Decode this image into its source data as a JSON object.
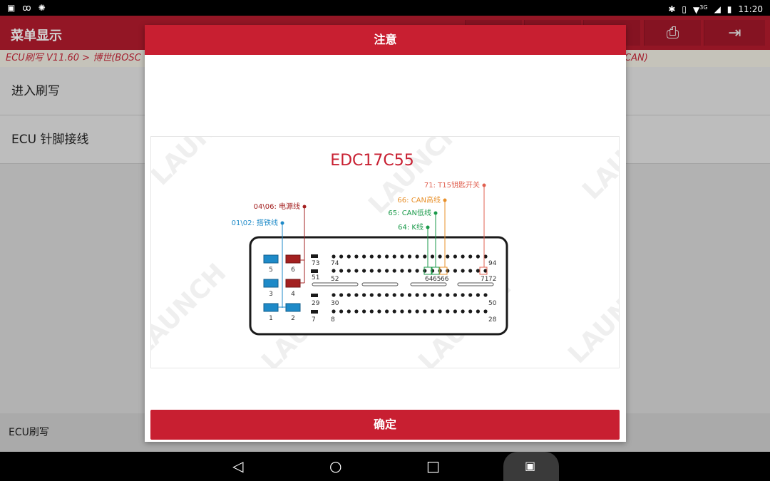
{
  "status_bar": {
    "time": "11:20",
    "network": "3G",
    "left_icons": [
      "image-icon",
      "voicemail-icon",
      "bug-icon"
    ],
    "right_icons": [
      "bluetooth-icon",
      "vibrate-icon",
      "wifi-icon",
      "signal-icon",
      "battery-icon"
    ]
  },
  "app_bar": {
    "title": "菜单显示",
    "toolbar_icons": [
      "print-icon",
      "exit-icon"
    ]
  },
  "breadcrumb": {
    "left": "ECU刷写 V11.60 > 博世(BOSC",
    "right": "CAN)"
  },
  "menu": {
    "items": [
      {
        "label": "进入刷写"
      },
      {
        "label": "ECU 针脚接线"
      }
    ]
  },
  "footer": {
    "label": "ECU刷写"
  },
  "dialog": {
    "title": "注意",
    "confirm_label": "确定",
    "diagram": {
      "model": "EDC17C55",
      "watermark": "LAUNCH",
      "annotations": {
        "t15": "71: T15钥匙开关",
        "can_high": "66: CAN高线",
        "power": "04\\06: 电源线",
        "can_low": "65: CAN低线",
        "ground": "01\\02: 搭铁线",
        "kline": "64: K线"
      },
      "pin_numbers": {
        "p73": "73",
        "p74": "74",
        "p94": "94",
        "p51": "51",
        "p52": "52",
        "p64": "64",
        "p65": "65",
        "p66": "66",
        "p71": "71",
        "p72": "72",
        "p29": "29",
        "p30": "30",
        "p50": "50",
        "p7": "7",
        "p8": "8",
        "p28": "28",
        "s5": "5",
        "s6": "6",
        "s3": "3",
        "s4": "4",
        "s1": "1",
        "s2": "2"
      },
      "colors": {
        "title": "#c81f31",
        "power": "#a32020",
        "t15": "#e06050",
        "can_high": "#e8902a",
        "can_low": "#1a9a4a",
        "ground": "#1e8ac8"
      }
    }
  }
}
